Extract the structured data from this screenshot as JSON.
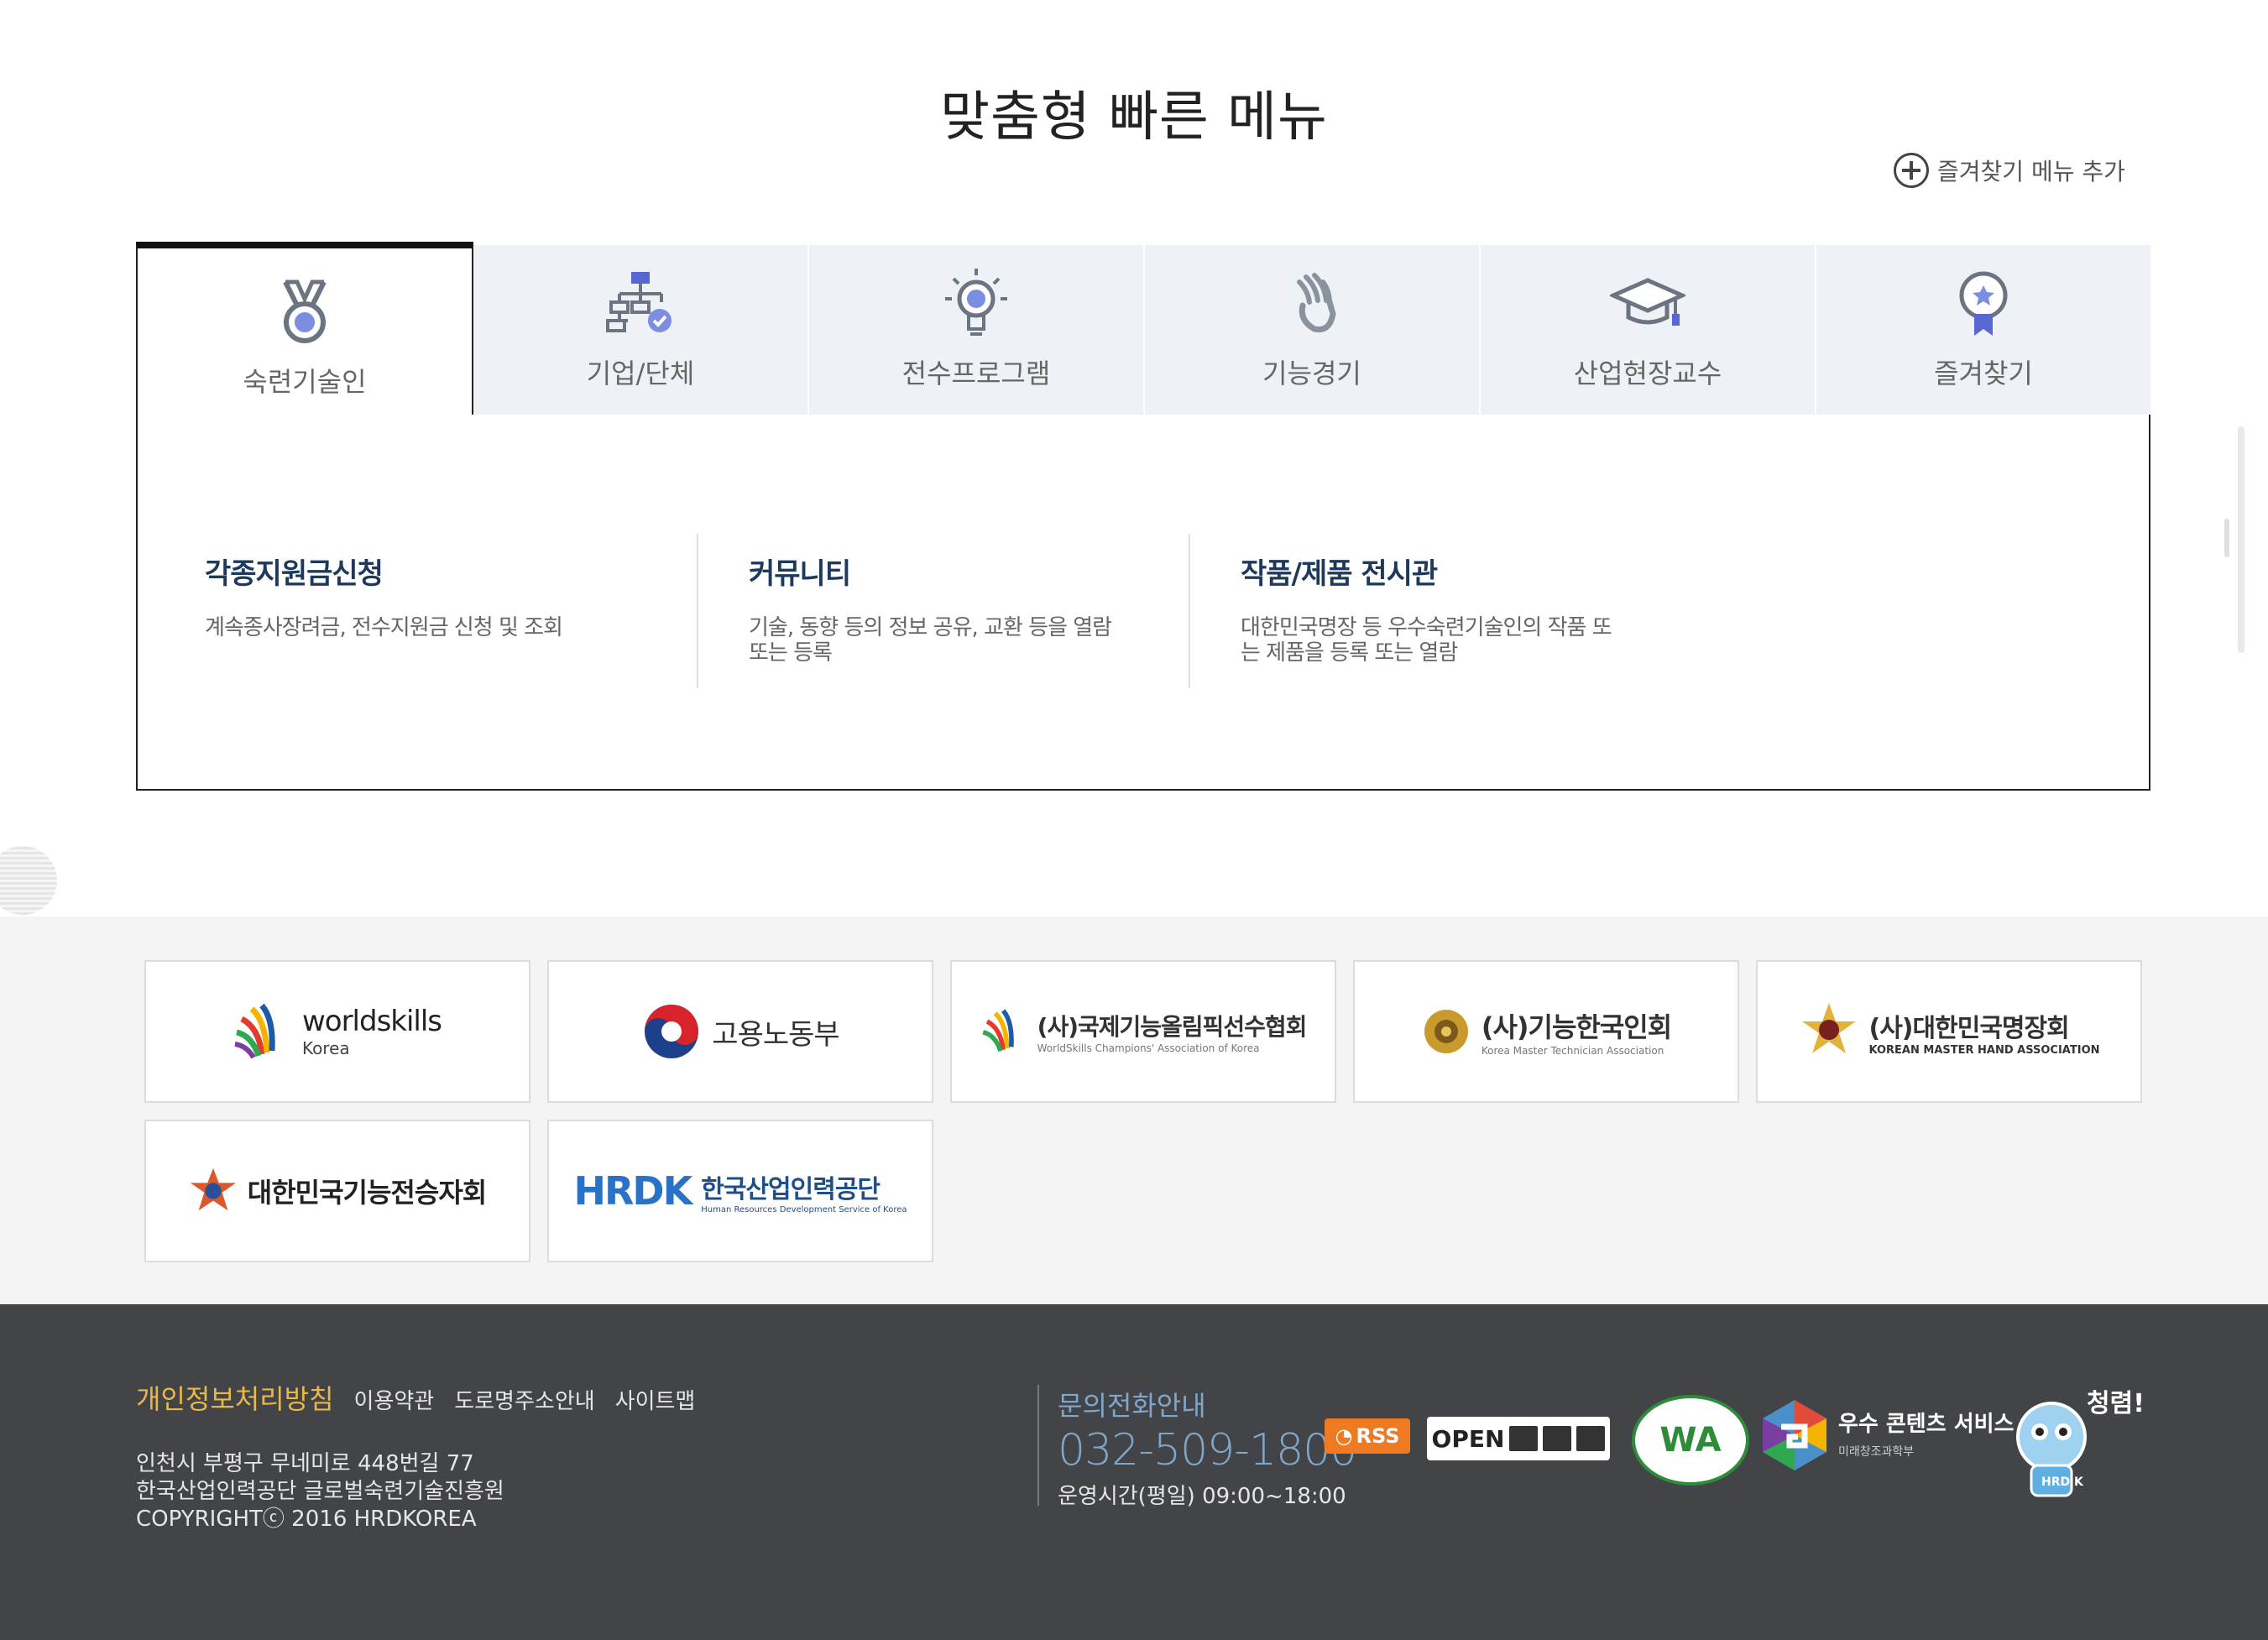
{
  "page_title": "맞춤형 빠른 메뉴",
  "favorites_add": {
    "label": "즐겨찾기 메뉴 추가",
    "icon": "plus-circle-icon"
  },
  "tabs": [
    {
      "label": "숙련기술인",
      "icon": "medal-icon",
      "active": true
    },
    {
      "label": "기업/단체",
      "icon": "org-chart-icon"
    },
    {
      "label": "전수프로그램",
      "icon": "lightbulb-icon"
    },
    {
      "label": "기능경기",
      "icon": "hand-icon"
    },
    {
      "label": "산업현장교수",
      "icon": "graduation-cap-icon"
    },
    {
      "label": "즐겨찾기",
      "icon": "award-ribbon-icon"
    }
  ],
  "menu_items": [
    {
      "title": "각종지원금신청",
      "desc": "계속종사장려금, 전수지원금 신청 및 조회"
    },
    {
      "title": "커뮤니티",
      "desc": "기술, 동향 등의 정보 공유, 교환 등을 열람 또는 등록"
    },
    {
      "title": "작품/제품 전시관",
      "desc": "대한민국명장 등 우수숙련기술인의 작품 또는 제품을 등록 또는 열람"
    }
  ],
  "partners": [
    {
      "name": "worldskills",
      "sub": "Korea"
    },
    {
      "name": "고용노동부",
      "sub": ""
    },
    {
      "name": "(사)국제기능올림픽선수협회",
      "sub": "WorldSkills Champions' Association of Korea"
    },
    {
      "name": "(사)기능한국인회",
      "sub": "Korea Master Technician Association"
    },
    {
      "name": "(사)대한민국명장회",
      "sub": "KOREAN MASTER HAND ASSOCIATION"
    },
    {
      "name": "대한민국기능전승자회",
      "sub": ""
    },
    {
      "name": "한국산업인력공단",
      "sub": "Human Resources Development Service of Korea",
      "mark": "HRDK"
    }
  ],
  "footer": {
    "privacy": "개인정보처리방침",
    "links": [
      "이용약관",
      "도로명주소안내",
      "사이트맵"
    ],
    "address_lines": [
      "인천시 부평구 무네미로 448번길 77",
      "한국산업인력공단 글로벌숙련기술진흥원",
      "COPYRIGHTⓒ 2016 HRDKOREA"
    ],
    "contact_title": "문의전화안내",
    "phone": "032-509-1800",
    "hours": "운영시간(평일) 09:00~18:00",
    "rss_label": "RSS",
    "open_label": "OPEN",
    "wa_label": "WA",
    "best_title": "우수 콘텐츠 서비스",
    "best_sub": "미래창조과학부",
    "mascot_text": "청렴!",
    "mascot_badge": "HRD K"
  },
  "colors": {
    "accent_navy": "#1d3a5c",
    "footer_bg": "#434447",
    "privacy_gold": "#e8b84a",
    "phone_blue": "#7fa7c9"
  }
}
